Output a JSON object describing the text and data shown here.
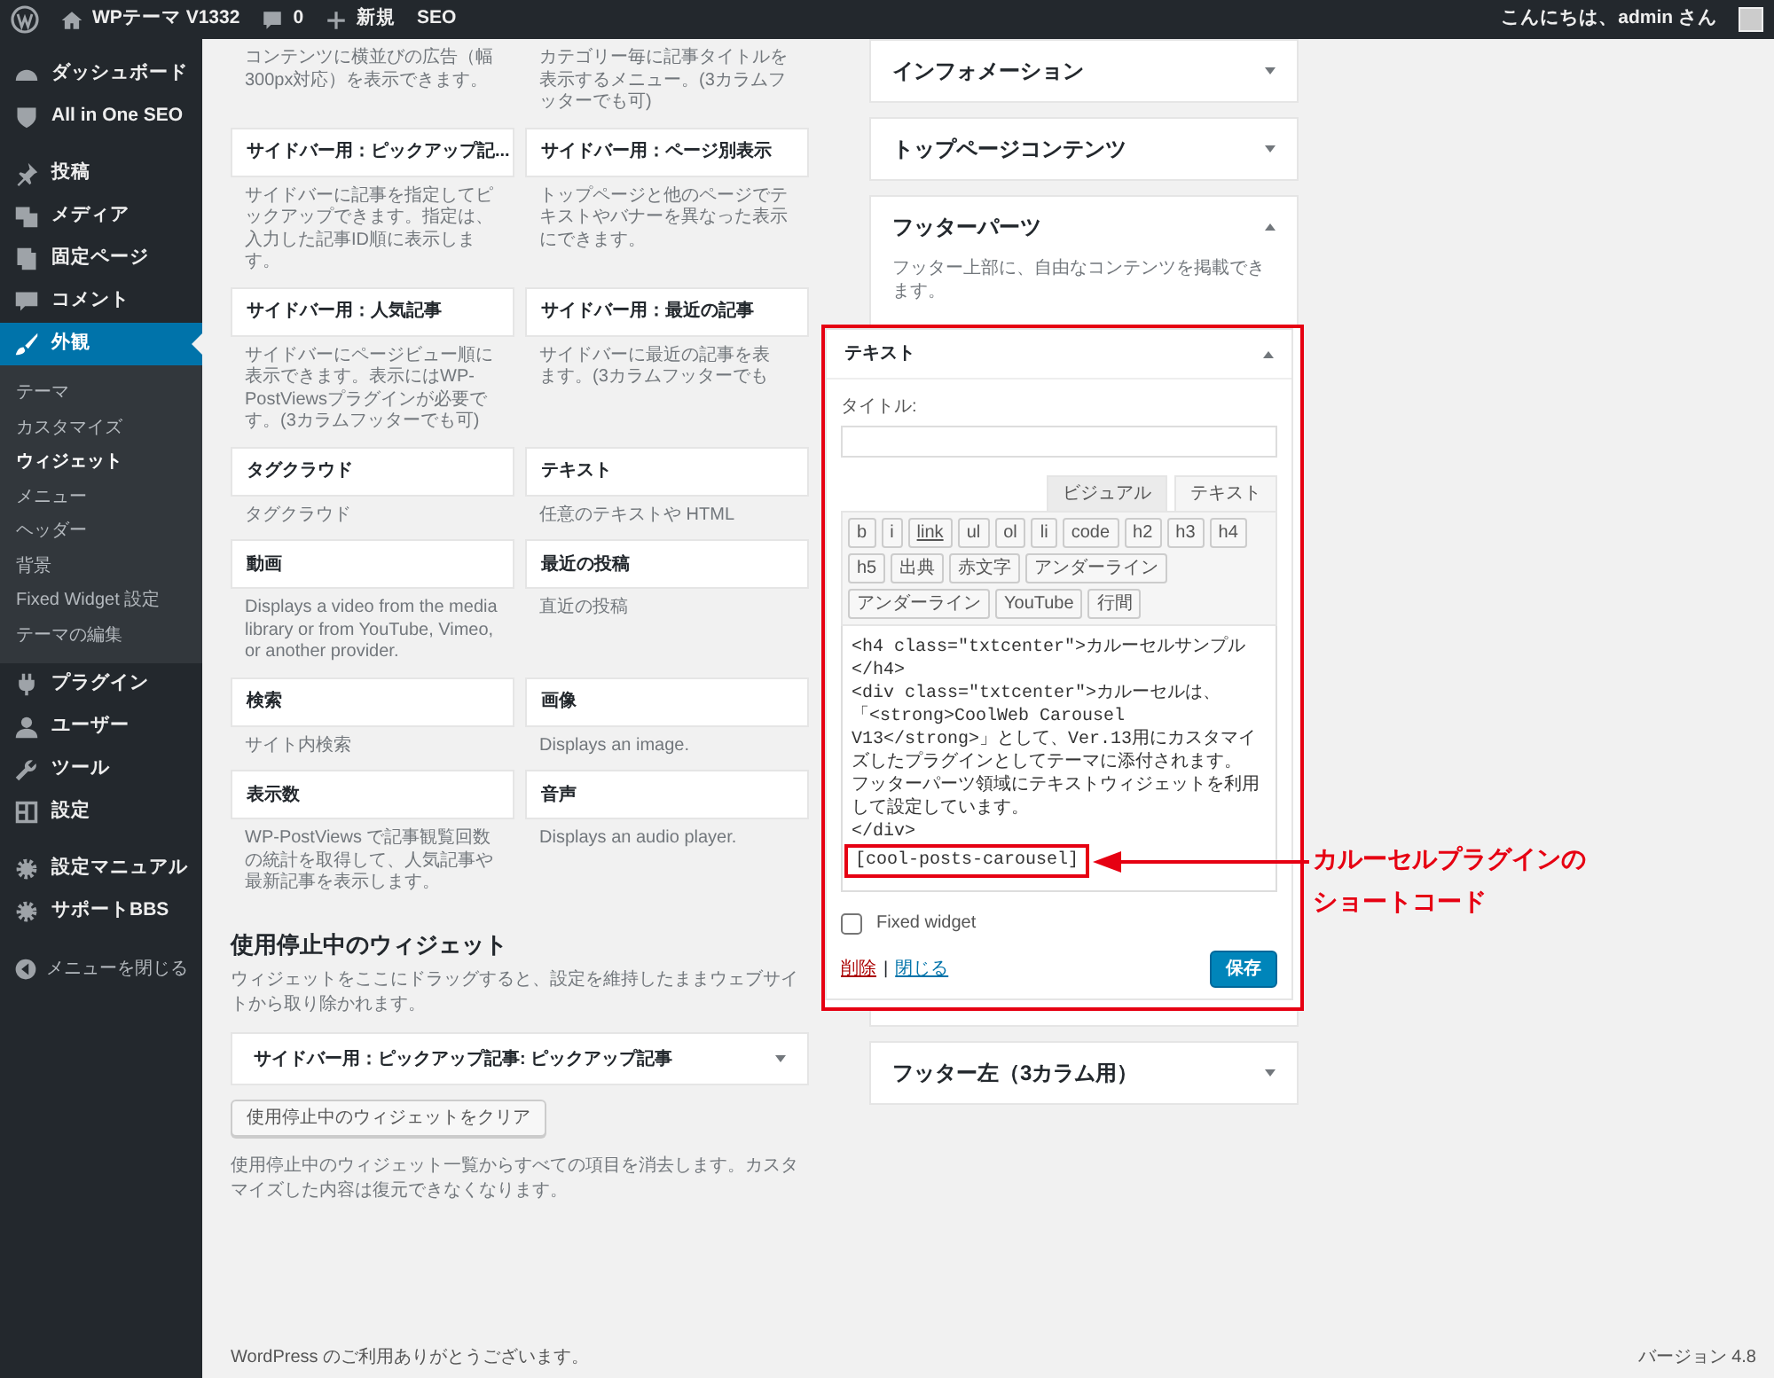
{
  "admin_bar": {
    "site_name": "WPテーマ V1332",
    "comment_count": "0",
    "new_label": "新規",
    "seo_label": "SEO",
    "greeting": "こんにちは、admin さん"
  },
  "sidebar": {
    "groups": [
      [
        {
          "label": "ダッシュボード",
          "selected": false
        },
        {
          "label": "All in One SEO",
          "selected": false
        }
      ],
      [
        {
          "label": "投稿",
          "selected": false
        },
        {
          "label": "メディア",
          "selected": false
        },
        {
          "label": "固定ページ",
          "selected": false
        },
        {
          "label": "コメント",
          "selected": false
        },
        {
          "label": "外観",
          "selected": true,
          "children": [
            {
              "label": "テーマ",
              "selected": false
            },
            {
              "label": "カスタマイズ",
              "selected": false
            },
            {
              "label": "ウィジェット",
              "selected": true
            },
            {
              "label": "メニュー",
              "selected": false
            },
            {
              "label": "ヘッダー",
              "selected": false
            },
            {
              "label": "背景",
              "selected": false
            },
            {
              "label": "Fixed Widget 設定",
              "selected": false
            },
            {
              "label": "テーマの編集",
              "selected": false
            }
          ]
        },
        {
          "label": "プラグイン",
          "selected": false
        },
        {
          "label": "ユーザー",
          "selected": false
        },
        {
          "label": "ツール",
          "selected": false
        },
        {
          "label": "設定",
          "selected": false
        }
      ],
      [
        {
          "label": "設定マニュアル",
          "selected": false
        },
        {
          "label": "サポートBBS",
          "selected": false
        }
      ]
    ],
    "collapse": "メニューを閉じる"
  },
  "available_widgets": [
    {
      "description": [
        "コンテンツに横並びの広告（幅300px対応）を表示できます。"
      ]
    },
    {
      "description": [
        "カテゴリー毎に記事タイトルを表示するメニュー。(3カラムフッターでも可)"
      ]
    },
    {
      "title": "サイドバー用：ピックアップ記...",
      "description": [
        "サイドバーに記事を指定してピックアップできます。指定は、入力した記事ID順に表示します。"
      ]
    },
    {
      "title": "サイドバー用：ページ別表示",
      "description": [
        "トップページと他のページでテキストやバナーを異なった表示にできます。"
      ]
    },
    {
      "title": "サイドバー用：人気記事",
      "description": [
        "サイドバーにページビュー順に表示できます。表示にはWP-PostViewsプラグインが必要です。(3カラムフッターでも可)"
      ]
    },
    {
      "title": "サイドバー用：最近の記事",
      "description": [
        "サイドバーに最近の記事を表",
        "ます。(3カラムフッターでも"
      ]
    },
    {
      "title": "タグクラウド",
      "description": [
        "タグクラウド"
      ]
    },
    {
      "title": "テキスト",
      "description": [
        "任意のテキストや HTML"
      ]
    },
    {
      "title": "動画",
      "description": [
        "Displays a video from the media library or from YouTube, Vimeo, or another provider."
      ]
    },
    {
      "title": "最近の投稿",
      "description": [
        "直近の投稿"
      ]
    },
    {
      "title": "検索",
      "description": [
        "サイト内検索"
      ]
    },
    {
      "title": "画像",
      "description": [
        "Displays an image."
      ]
    },
    {
      "title": "表示数",
      "description": [
        "WP-PostViews で記事観覧回数の統計を取得して、人気記事や最新記事を表示します。"
      ]
    },
    {
      "title": "音声",
      "description": [
        "Displays an audio player."
      ]
    }
  ],
  "inactive": {
    "heading": "使用停止中のウィジェット",
    "description": "ウィジェットをここにドラッグすると、設定を維持したままウェブサイトから取り除かれます。",
    "widgets": [
      {
        "title": "サイドバー用：ピックアップ記事: ピックアップ記事",
        "expanded": false
      }
    ],
    "clear_button": "使用停止中のウィジェットをクリア",
    "note": "使用停止中のウィジェット一覧からすべての項目を消去します。カスタマイズした内容は復元できなくなります。"
  },
  "widget_areas": [
    {
      "title": "インフォメーション",
      "expanded": false
    },
    {
      "title": "トップページコンテンツ",
      "expanded": false
    },
    {
      "title": "フッターパーツ",
      "expanded": true,
      "description": "フッター上部に、自由なコンテンツを掲載できます。",
      "widgets": [
        {
          "title": "テキスト",
          "expanded": true,
          "title_label": "タイトル:",
          "tabs": [
            {
              "label": "ビジュアル",
              "selected": false
            },
            {
              "label": "テキスト",
              "selected": true
            }
          ],
          "quicktags": [
            {
              "label": "b",
              "underlined": false
            },
            {
              "label": "i",
              "underlined": false
            },
            {
              "label": "link",
              "underlined": true
            },
            {
              "label": "ul",
              "underlined": false
            },
            {
              "label": "ol",
              "underlined": false
            },
            {
              "label": "li",
              "underlined": false
            },
            {
              "label": "code",
              "underlined": false
            },
            {
              "label": "h2",
              "underlined": false
            },
            {
              "label": "h3",
              "underlined": false
            },
            {
              "label": "h4",
              "underlined": false
            },
            {
              "label": "h5",
              "underlined": false
            },
            {
              "label": "出典",
              "underlined": false
            },
            {
              "label": "赤文字",
              "underlined": false
            },
            {
              "label": "アンダーライン",
              "underlined": false
            },
            {
              "label": "アンダーライン",
              "underlined": false
            },
            {
              "label": "YouTube",
              "underlined": false
            },
            {
              "label": "行間",
              "underlined": false
            }
          ],
          "content_lines": [
            "<h4 class=\"txtcenter\">カルーセルサンプル</h4>",
            "<div class=\"txtcenter\">カルーセルは、「<strong>CoolWeb Carousel V13</strong>」として、Ver.13用にカスタマイズしたプラグインとしてテーマに添付されます。",
            "フッターパーツ領域にテキストウィジェットを利用して設定しています。",
            "</div>"
          ],
          "shortcode": "[cool-posts-carousel]",
          "fixed_widget": {
            "label": "Fixed widget",
            "checked": false
          },
          "delete_link": "削除",
          "separator": "|",
          "close_link": "閉じる",
          "save_button": "保存"
        }
      ]
    },
    {
      "title": "フッター左（3カラム用）",
      "expanded": false
    }
  ],
  "annotation": {
    "text": "カルーセルプラグインのショートコード"
  },
  "footer": {
    "thanks_link": "WordPress",
    "thanks_text": " のご利用ありがとうございます。",
    "version": "バージョン 4.8"
  }
}
